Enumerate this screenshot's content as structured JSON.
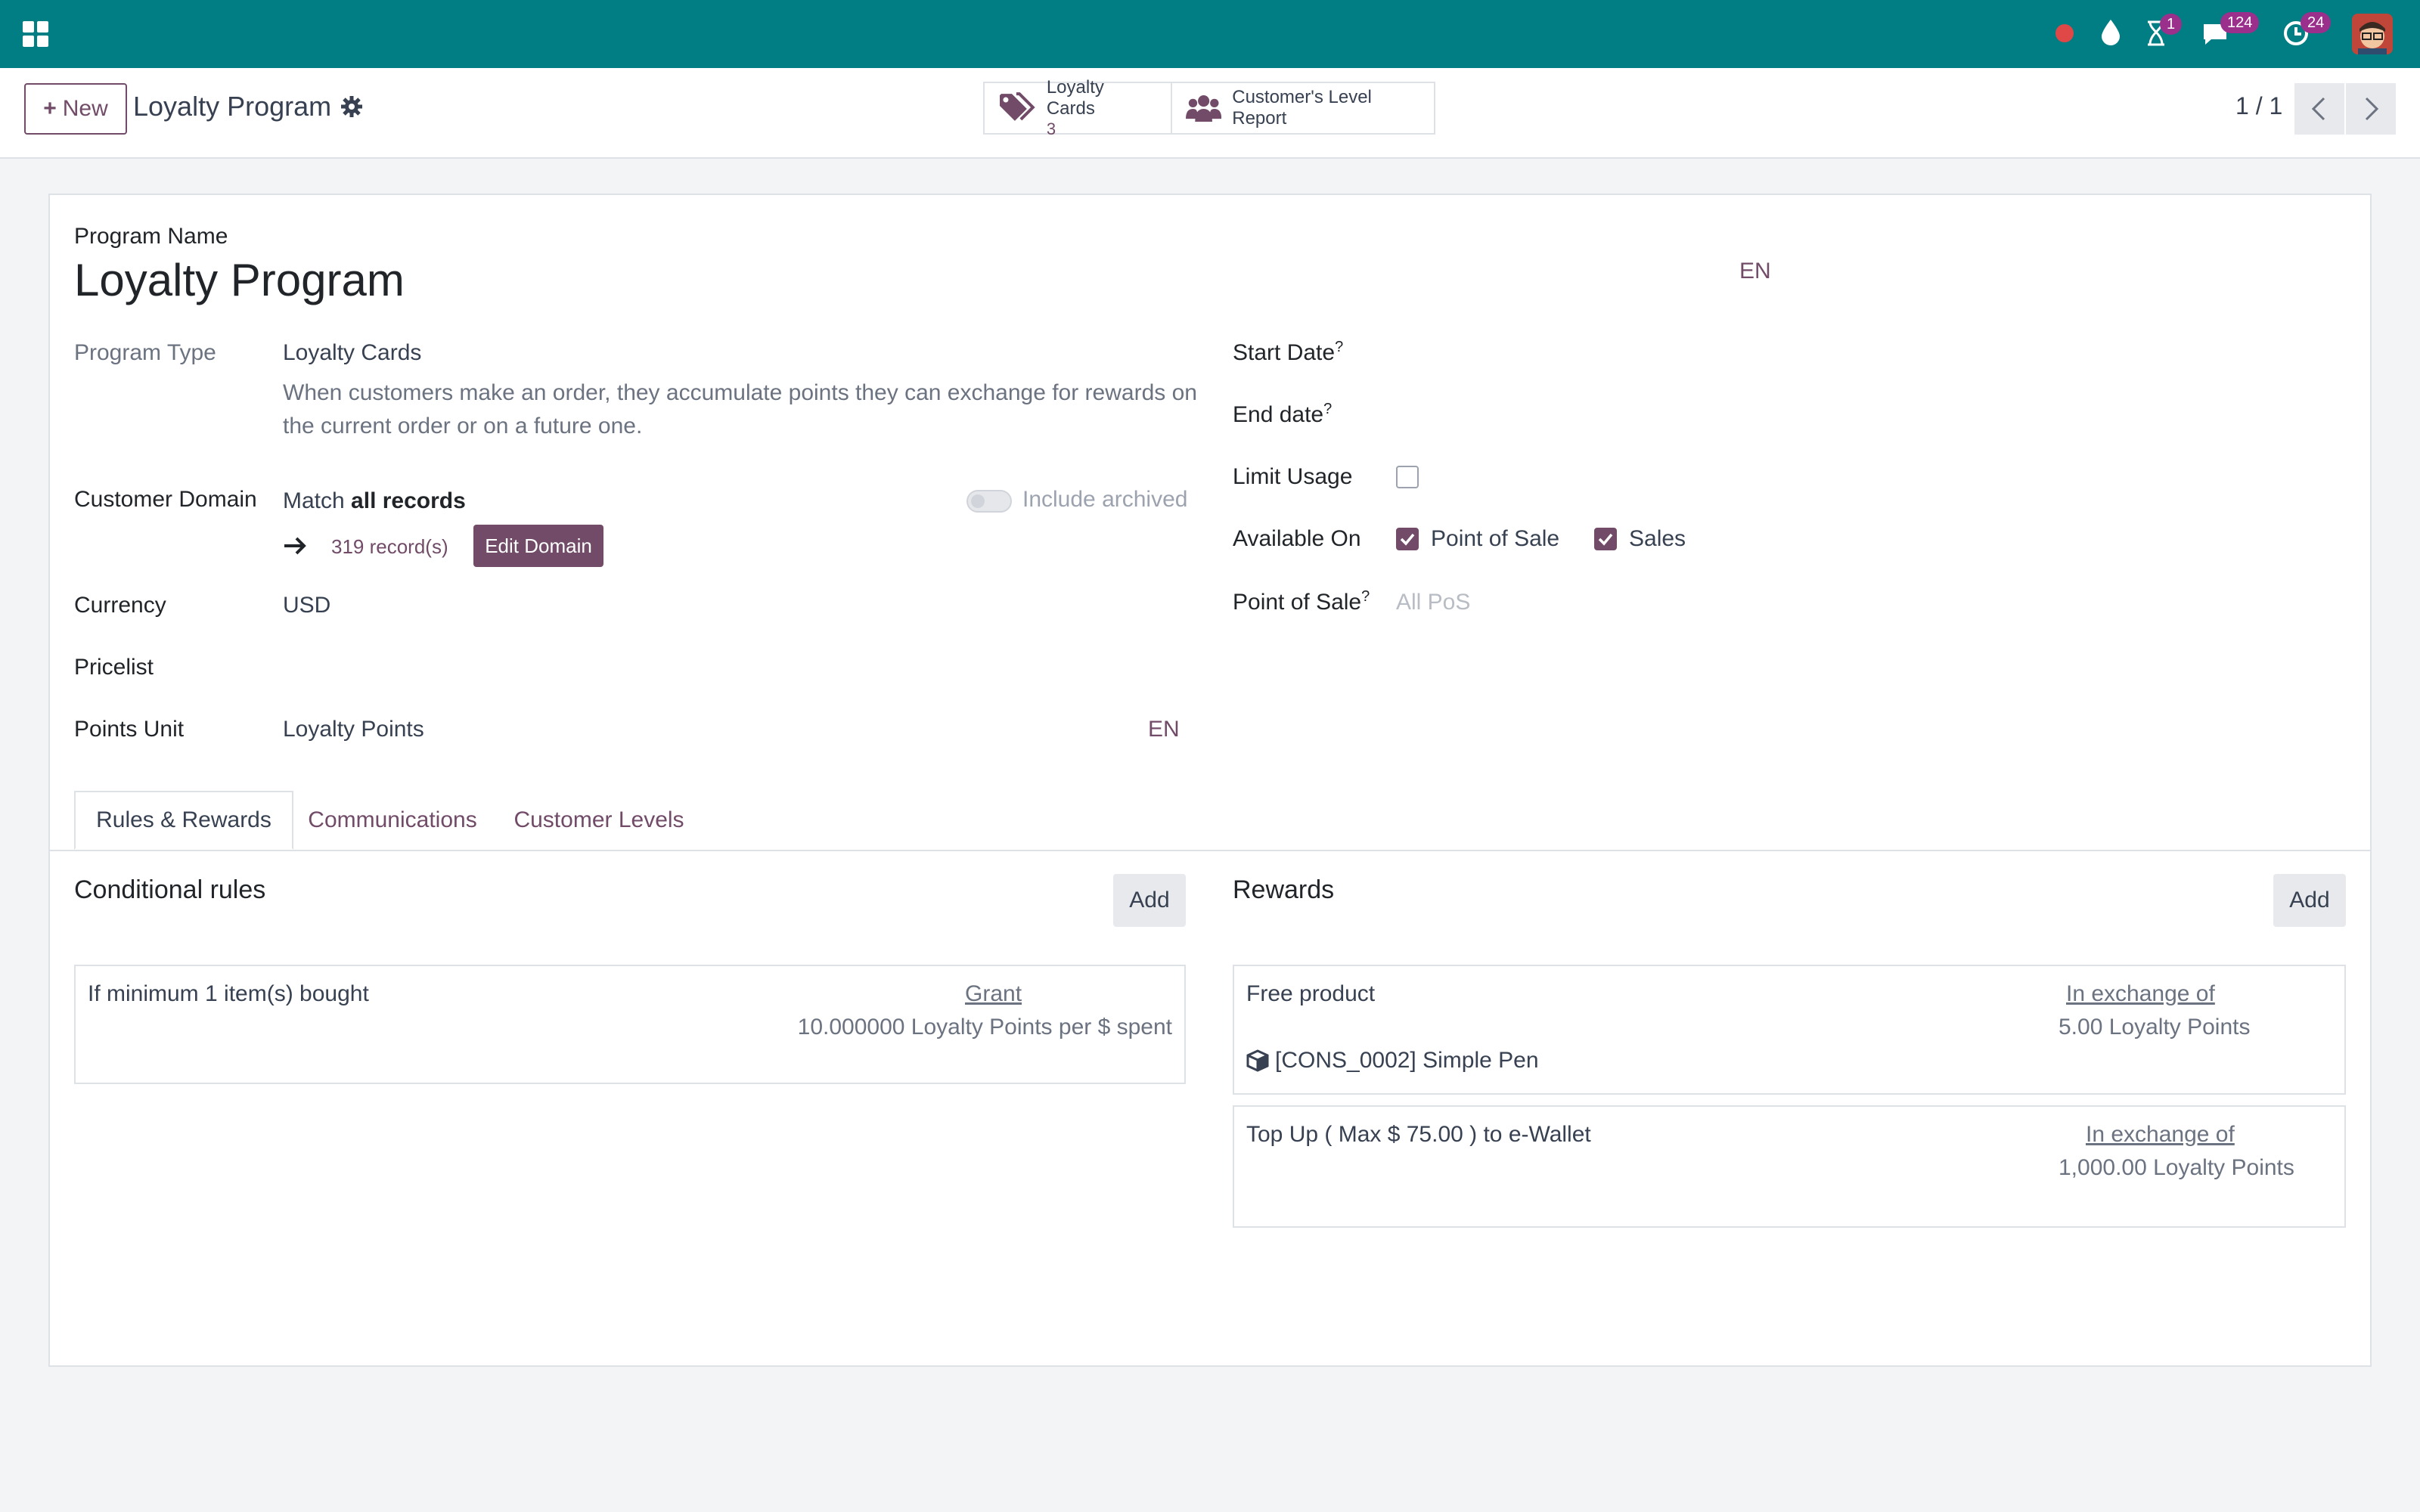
{
  "navbar": {
    "apps_icon": "grid-icon",
    "activity_badge": "1",
    "messages_badge": "124",
    "clock_badge": "24"
  },
  "control_panel": {
    "new_label": "New",
    "breadcrumb_title": "Loyalty Program",
    "smart_buttons": {
      "loyalty_cards_label": "Loyalty Cards",
      "loyalty_cards_count": "3",
      "level_report_label": "Customer's Level Report"
    },
    "pager": "1 / 1"
  },
  "form": {
    "program_name_label": "Program Name",
    "program_name_value": "Loyalty Program",
    "program_name_lang": "EN",
    "program_type_label": "Program Type",
    "program_type_value": "Loyalty Cards",
    "program_type_help": "When customers make an order, they accumulate points they can exchange for rewards on the current order or on a future one.",
    "customer_domain_label": "Customer Domain",
    "domain_match_prefix": "Match",
    "domain_match_value": "all records",
    "include_archived_label": "Include archived",
    "records_count": "319 record(s)",
    "edit_domain_label": "Edit Domain",
    "currency_label": "Currency",
    "currency_value": "USD",
    "pricelist_label": "Pricelist",
    "points_unit_label": "Points Unit",
    "points_unit_value": "Loyalty Points",
    "points_unit_lang": "EN",
    "start_date_label": "Start Date",
    "end_date_label": "End date",
    "help_mark": "?",
    "limit_usage_label": "Limit Usage",
    "available_on_label": "Available On",
    "available_pos_label": "Point of Sale",
    "available_sales_label": "Sales",
    "point_of_sale_label": "Point of Sale",
    "point_of_sale_placeholder": "All PoS"
  },
  "tabs": [
    {
      "label": "Rules & Rewards"
    },
    {
      "label": "Communications"
    },
    {
      "label": "Customer Levels"
    }
  ],
  "rules": {
    "title": "Conditional rules",
    "add_label": "Add",
    "items": [
      {
        "condition": "If minimum 1 item(s) bought",
        "grant_label": "Grant",
        "grant_value": "10.000000 Loyalty Points per $ spent"
      }
    ]
  },
  "rewards": {
    "title": "Rewards",
    "add_label": "Add",
    "items": [
      {
        "title": "Free product",
        "exchange_label": "In exchange of",
        "exchange_value": "5.00 Loyalty Points",
        "product": "[CONS_0002] Simple Pen"
      },
      {
        "title": "Top Up ( Max $ 75.00 ) to e-Wallet",
        "exchange_label": "In exchange of",
        "exchange_value": "1,000.00 Loyalty Points"
      }
    ]
  },
  "colors": {
    "navbar": "#017e84",
    "brand": "#714b67",
    "badge": "#9b2f8c"
  }
}
